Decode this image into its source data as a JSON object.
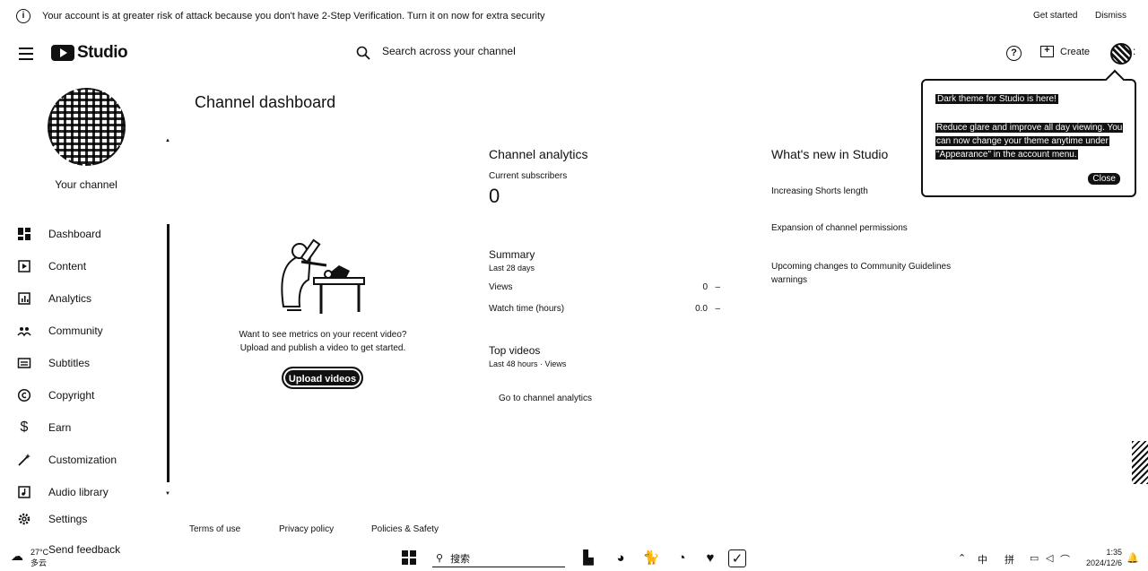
{
  "banner": {
    "message": "Your account is at greater risk of attack because you don't have 2-Step Verification. Turn it on now for extra security",
    "get_started": "Get started",
    "dismiss": "Dismiss"
  },
  "header": {
    "logo_text": "Studio",
    "search_placeholder": "Search across your channel",
    "create_label": "Create"
  },
  "sidebar": {
    "channel_label": "Your channel",
    "items": [
      {
        "label": "Dashboard",
        "icon": "dashboard-icon"
      },
      {
        "label": "Content",
        "icon": "content-icon"
      },
      {
        "label": "Analytics",
        "icon": "analytics-icon"
      },
      {
        "label": "Community",
        "icon": "community-icon"
      },
      {
        "label": "Subtitles",
        "icon": "subtitles-icon"
      },
      {
        "label": "Copyright",
        "icon": "copyright-icon"
      },
      {
        "label": "Earn",
        "icon": "dollar-icon"
      },
      {
        "label": "Customization",
        "icon": "customization-icon"
      },
      {
        "label": "Audio library",
        "icon": "audio-library-icon"
      }
    ],
    "settings": "Settings",
    "feedback": "Send feedback"
  },
  "main": {
    "title": "Channel dashboard",
    "empty_line1": "Want to see metrics on your recent video?",
    "empty_line2": "Upload and publish a video to get started.",
    "upload_button": "Upload videos"
  },
  "analytics": {
    "title": "Channel analytics",
    "subscribers_label": "Current subscribers",
    "subscribers_value": "0",
    "summary_title": "Summary",
    "summary_period": "Last 28 days",
    "metrics": [
      {
        "label": "Views",
        "value": "0",
        "trend": "–"
      },
      {
        "label": "Watch time (hours)",
        "value": "0.0",
        "trend": "–"
      }
    ],
    "top_videos_title": "Top videos",
    "top_videos_period": "Last 48 hours · Views",
    "go_link": "Go to channel analytics"
  },
  "whats_new": {
    "title": "What's new in Studio",
    "items": [
      "Increasing Shorts length",
      "Expansion of channel permissions",
      "Upcoming changes to Community Guidelines warnings"
    ]
  },
  "popup": {
    "title": "Dark theme for Studio is here!",
    "body": "Reduce glare and improve all day viewing. You can now change your theme anytime under \"Appearance\" in the account menu.",
    "close": "Close"
  },
  "footer": {
    "terms": "Terms of use",
    "privacy": "Privacy policy",
    "policies": "Policies & Safety"
  },
  "taskbar": {
    "temperature": "27°C",
    "condition": "多云",
    "search_label": "搜索",
    "ime_lang": "中",
    "ime_mode": "拼",
    "time": "1:35",
    "date": "2024/12/6"
  }
}
